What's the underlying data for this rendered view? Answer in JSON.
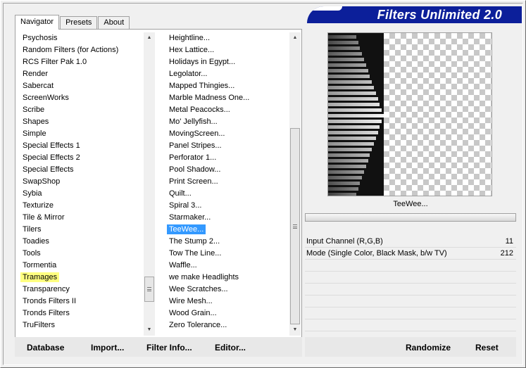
{
  "banner": {
    "title": "Filters Unlimited 2.0",
    "color": "#0c1f9a"
  },
  "tabs": [
    {
      "label": "Navigator",
      "active": true
    },
    {
      "label": "Presets",
      "active": false
    },
    {
      "label": "About",
      "active": false
    }
  ],
  "categories": {
    "items": [
      "Psychosis",
      "Random Filters (for Actions)",
      "RCS Filter Pak 1.0",
      "Render",
      "Sabercat",
      "ScreenWorks",
      "Scribe",
      "Shapes",
      "Simple",
      "Special Effects 1",
      "Special Effects 2",
      "Special Effects",
      "SwapShop",
      "Sybia",
      "Texturize",
      "Tile & Mirror",
      "Tilers",
      "Toadies",
      "Tools",
      "Tormentia",
      "Tramages",
      "Transparency",
      "Tronds Filters II",
      "Tronds Filters",
      "TruFilters"
    ],
    "highlighted": "Tramages"
  },
  "filters": {
    "items": [
      "Heightline...",
      "Hex Lattice...",
      "Holidays in Egypt...",
      "Legolator...",
      "Mapped Thingies...",
      "Marble Madness One...",
      "Metal Peacocks...",
      "Mo' Jellyfish...",
      "MovingScreen...",
      "Panel Stripes...",
      "Perforator 1...",
      "Pool Shadow...",
      "Print Screen...",
      "Quilt...",
      "Spiral 3...",
      "Starmaker...",
      "TeeWee...",
      "The Stump 2...",
      "Tow The Line...",
      "Waffle...",
      "we make Headlights",
      "Wee Scratches...",
      "Wire Mesh...",
      "Wood Grain...",
      "Zero Tolerance..."
    ],
    "selected": "TeeWee..."
  },
  "selected_filter_name": "TeeWee...",
  "params": [
    {
      "label": "Input Channel (R,G,B)",
      "value": "11"
    },
    {
      "label": "Mode (Single Color, Black Mask, b/w TV)",
      "value": "212"
    }
  ],
  "buttons": {
    "database": "Database",
    "import": "Import...",
    "filter_info": "Filter Info...",
    "editor": "Editor...",
    "randomize": "Randomize",
    "reset": "Reset"
  },
  "icons": {
    "scroll_up": "scroll-up-arrow-icon",
    "scroll_down": "scroll-down-arrow-icon",
    "grip": "scrollbar-grip-icon"
  },
  "colors": {
    "selection": "#3399ff",
    "highlight": "#ffff80"
  }
}
